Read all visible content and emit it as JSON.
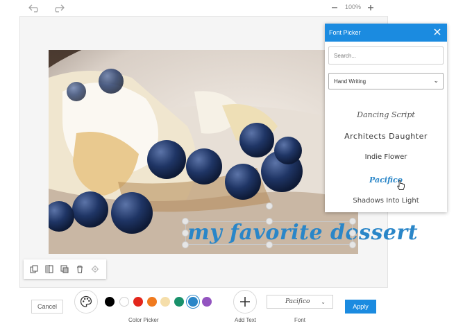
{
  "topbar": {
    "undo_icon": "undo-icon",
    "redo_icon": "redo-icon",
    "zoom_out_icon": "minus-icon",
    "zoom_level": "100%",
    "zoom_in_icon": "plus-icon"
  },
  "canvas": {
    "photo_description_icon": "photo-image",
    "overlay_text": "my favorite dessert",
    "overlay_text_color": "#2a86c8"
  },
  "toolbox": {
    "items": [
      "copy-icon",
      "flip-icon",
      "layer-icon",
      "trash-icon",
      "settings-icon"
    ]
  },
  "bottom": {
    "cancel_label": "Cancel",
    "color_picker_label": "Color Picker",
    "colors": [
      "#000000",
      "#ffffff",
      "#e3261c",
      "#f07a1f",
      "#f5deaa",
      "#19916b",
      "#2a86c8",
      "#9354c0"
    ],
    "selected_color": "#2a86c8",
    "add_text_label": "Add Text",
    "font_label": "Font",
    "font_value": "Pacifico",
    "apply_label": "Apply"
  },
  "font_picker": {
    "title": "Font Picker",
    "search_placeholder": "Search...",
    "category": "Hand Writing",
    "fonts": [
      "Dancing Script",
      "Architects Daughter",
      "Indie Flower",
      "Pacifico",
      "Shadows Into Light"
    ],
    "selected_font": "Pacifico"
  }
}
